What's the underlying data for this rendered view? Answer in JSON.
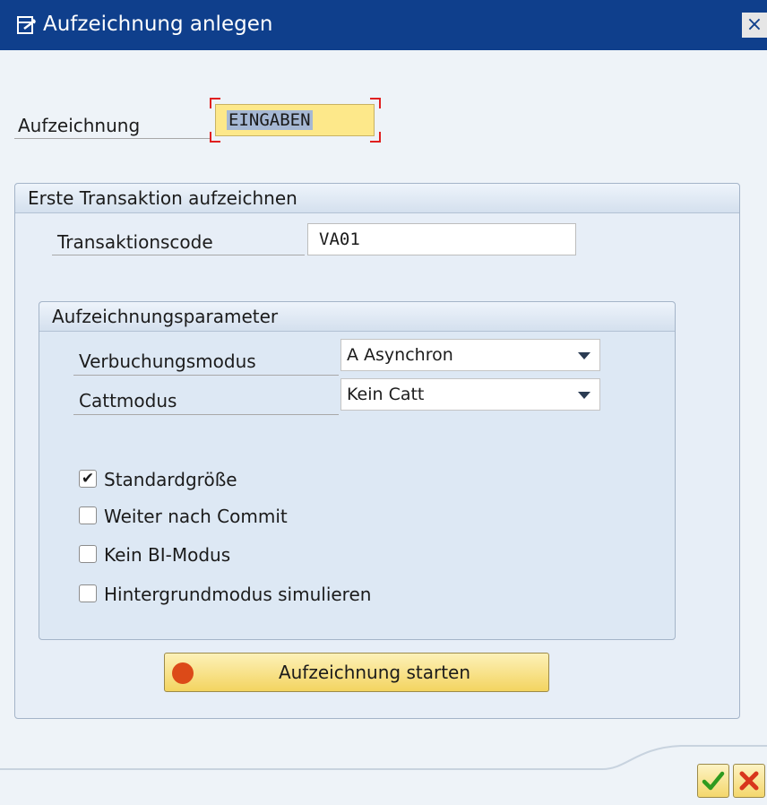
{
  "window": {
    "title": "Aufzeichnung anlegen",
    "close_symbol": "×"
  },
  "recording": {
    "label": "Aufzeichnung",
    "value": "EINGABEN",
    "required": true,
    "focused": true
  },
  "first_transaction": {
    "group_title": "Erste Transaktion aufzeichnen",
    "tcode_label": "Transaktionscode",
    "tcode_value": "VA01"
  },
  "parameters": {
    "group_title": "Aufzeichnungsparameter",
    "update_mode_label": "Verbuchungsmodus",
    "update_mode_value": "A Asynchron",
    "catt_mode_label": "Cattmodus",
    "catt_mode_value": "Kein Catt",
    "checkboxes": [
      {
        "label": "Standardgröße",
        "checked": true
      },
      {
        "label": "Weiter nach Commit",
        "checked": false
      },
      {
        "label": "Kein BI-Modus",
        "checked": false
      },
      {
        "label": "Hintergrundmodus simulieren",
        "checked": false
      }
    ]
  },
  "start_button": {
    "label": "Aufzeichnung starten",
    "icon": "record-icon"
  },
  "footer": {
    "ok_icon": "check-icon",
    "cancel_icon": "cancel-icon"
  },
  "colors": {
    "titlebar": "#0f3f8c",
    "focused_field": "#fde88a",
    "required_marker": "#e02020",
    "record_dot": "#dc4a18",
    "button_yellow": "#f3d460"
  }
}
